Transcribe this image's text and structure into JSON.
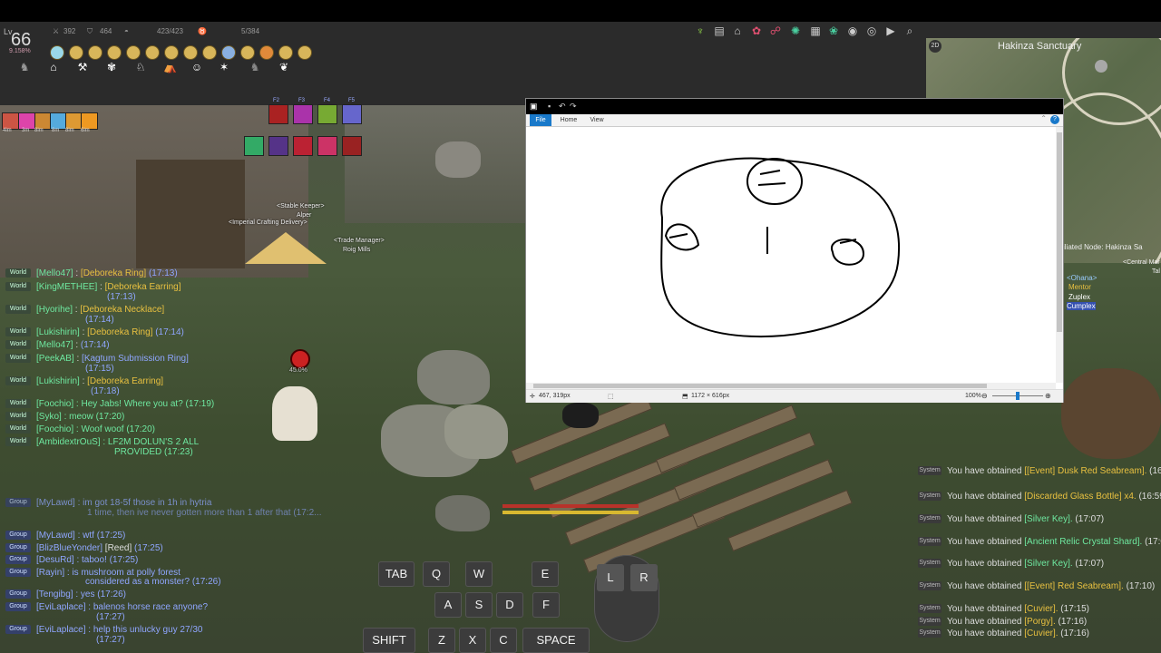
{
  "hud": {
    "level_label": "Lv",
    "level": "66",
    "level_percent": "9.158%",
    "stats": [
      "392",
      "464",
      "423/423",
      "5/384"
    ]
  },
  "minimap": {
    "title": "Hakinza Sanctuary",
    "mode": "2D",
    "node_label": "iliated Node: Hakinza Sa",
    "central_label": "<Central Mar",
    "central_label2": "Tal",
    "party": [
      "<Ohana>",
      "Mentor",
      "Zuplex",
      "Cumplex"
    ]
  },
  "skills": {
    "top_labels": [
      "F2",
      "F3",
      "F4",
      "F5"
    ]
  },
  "buff_timers": [
    "4lm",
    "3m",
    "8lm",
    "8m",
    "8lm",
    "6lm"
  ],
  "npcs": [
    {
      "line1": "<Stable Keeper>",
      "line2": "Alper"
    },
    {
      "line1": "<Imperial Crafting Delivery>",
      "line2": ""
    },
    {
      "line1": "<Trade Manager>",
      "line2": "Roig Mills"
    }
  ],
  "player_hp": "45.0%",
  "chat": [
    {
      "tag": "World",
      "name": "[Mello47]",
      "text": "[Deboreka Ring]",
      "time": "(17:13)"
    },
    {
      "tag": "World",
      "name": "[KingMETHEE]",
      "text": "[Deboreka Earring]",
      "time": "(17:13)"
    },
    {
      "tag": "World",
      "name": "[Hyorihe]",
      "text": "[Deboreka Necklace]",
      "time": "(17:14)"
    },
    {
      "tag": "World",
      "name": "[Lukishirin]",
      "text": "[Deboreka Ring]",
      "time": "(17:14)"
    },
    {
      "tag": "World",
      "name": "[Mello47]",
      "text": "",
      "time": "(17:14)"
    },
    {
      "tag": "World",
      "name": "[PeekAB]",
      "text": "[Kagtum Submission Ring]",
      "time": "(17:15)"
    },
    {
      "tag": "World",
      "name": "[Lukishirin]",
      "text": "[Deboreka Earring]",
      "time": "(17:18)"
    },
    {
      "tag": "World",
      "name": "[Foochio]",
      "text": ": Hey Jabs! Where you at?",
      "time": "(17:19)"
    },
    {
      "tag": "World",
      "name": "[Syko]",
      "text": ": meow",
      "time": "(17:20)"
    },
    {
      "tag": "World",
      "name": "[Foochio]",
      "text": ": Woof woof",
      "time": "(17:20)"
    },
    {
      "tag": "World",
      "name": "[AmbidextrOuS]",
      "text": ": LF2M DOLUN'S 2 ALL",
      "time": "PROVIDED (17:23)"
    },
    {
      "tag": "Group",
      "name": "[MyLawd]",
      "text": ": im got 18-5f those in 1h in hytria",
      "time": "1 time, then ive never gotten more than 1 after that (17:2..."
    },
    {
      "tag": "Group",
      "name": "[MyLawd]",
      "text": ": wtf",
      "time": "(17:25)"
    },
    {
      "tag": "Group",
      "name": "[BlizBlueYonder]",
      "text": "[Reed]",
      "time": "(17:25)"
    },
    {
      "tag": "Group",
      "name": "[DesuRd]",
      "text": ": taboo!",
      "time": "(17:25)"
    },
    {
      "tag": "Group",
      "name": "[Rayin]",
      "text": ": is mushroom at polly forest",
      "time": "considered as a monster? (17:26)"
    },
    {
      "tag": "Group",
      "name": "[Tengibg]",
      "text": ": yes",
      "time": "(17:26)"
    },
    {
      "tag": "Group",
      "name": "[EviLaplace]",
      "text": ": balenos horse race anyone?",
      "time": "(17:27)"
    },
    {
      "tag": "Group",
      "name": "[EviLaplace]",
      "text": ": help this unlucky guy 27/30",
      "time": "(17:27)"
    }
  ],
  "system_log": [
    {
      "tag": "System",
      "text": "You have obtained",
      "item": "[[Event] Dusk Red Seabream].",
      "time": "(16:58)"
    },
    {
      "tag": "System",
      "text": "You have obtained",
      "item": "[Discarded Glass Bottle] x4.",
      "time": "(16:59)"
    },
    {
      "tag": "System",
      "text": "You have obtained",
      "item": "[Silver Key].",
      "time": "(17:07)"
    },
    {
      "tag": "System",
      "text": "You have obtained",
      "item": "[Ancient Relic Crystal Shard].",
      "time": "(17:07)"
    },
    {
      "tag": "System",
      "text": "You have obtained",
      "item": "[Silver Key].",
      "time": "(17:07)"
    },
    {
      "tag": "System",
      "text": "You have obtained",
      "item": "[[Event] Red Seabream].",
      "time": "(17:10)"
    },
    {
      "tag": "System",
      "text": "You have obtained",
      "item": "[Cuvier].",
      "time": "(17:15)"
    },
    {
      "tag": "System",
      "text": "You have obtained",
      "item": "[Porgy].",
      "time": "(17:16)"
    },
    {
      "tag": "System",
      "text": "You have obtained",
      "item": "[Cuvier].",
      "time": "(17:16)"
    }
  ],
  "keys": {
    "tab": "TAB",
    "q": "Q",
    "w": "W",
    "e": "E",
    "a": "A",
    "s": "S",
    "d": "D",
    "f": "F",
    "shift": "SHIFT",
    "z": "Z",
    "x": "X",
    "c": "C",
    "space": "SPACE",
    "l": "L",
    "r": "R"
  },
  "paint": {
    "tabs": [
      "File",
      "Home",
      "View"
    ],
    "status_pos": "467, 319px",
    "status_size": "1172 × 616px",
    "zoom": "100%",
    "zoom_level": 0.5
  }
}
